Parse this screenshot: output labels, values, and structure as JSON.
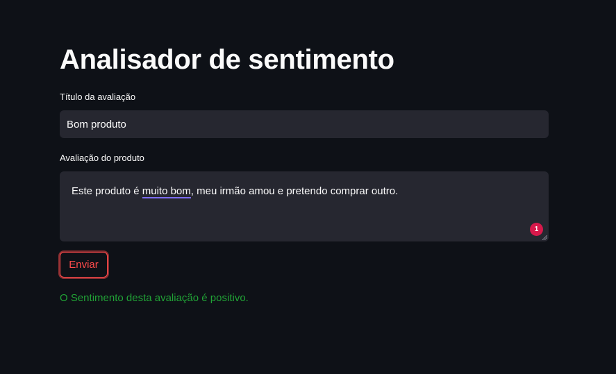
{
  "app": {
    "title": "Analisador de sentimento"
  },
  "form": {
    "title_label": "Título da avaliação",
    "title_value": "Bom produto",
    "review_label": "Avaliação do produto",
    "review_text_before": "Este produto é ",
    "review_text_underlined": "muito bom",
    "review_text_after": ", meu irmão amou e pretendo comprar outro.",
    "grammar_badge_count": "1",
    "submit_label": "Enviar"
  },
  "result": {
    "message": "O Sentimento desta avaliação é positivo."
  },
  "colors": {
    "background": "#0e1117",
    "input_bg": "#262730",
    "accent": "#ff4b4b",
    "success": "#21a336",
    "badge": "#d7194b",
    "spell_underline": "#7c6cf0"
  }
}
